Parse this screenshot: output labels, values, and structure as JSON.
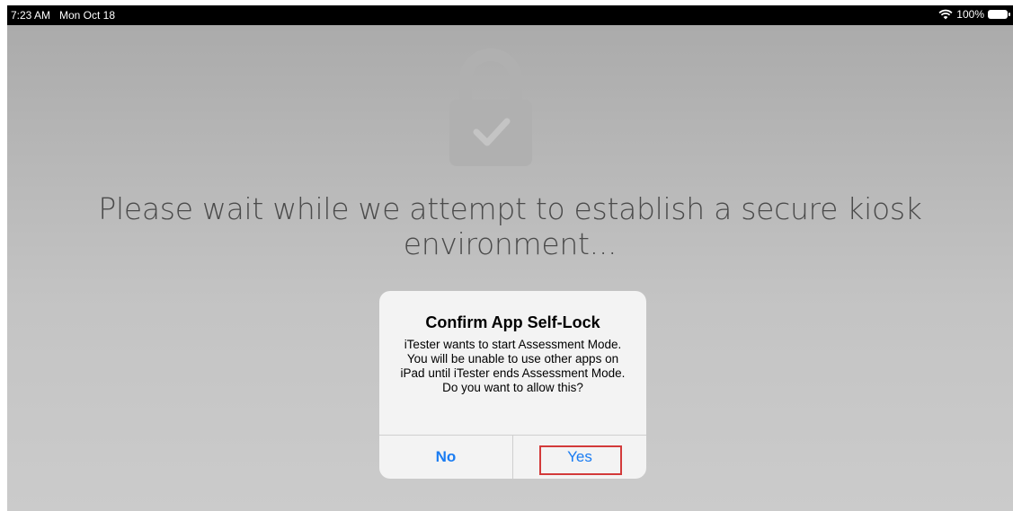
{
  "status_bar": {
    "time": "7:23 AM",
    "date": "Mon Oct 18",
    "battery": "100%"
  },
  "main": {
    "message": "Please wait while we attempt to establish a secure kiosk environment..."
  },
  "dialog": {
    "title": "Confirm App Self-Lock",
    "body": "iTester wants to start Assessment Mode. You will be unable to use other apps on iPad until iTester ends Assessment Mode. Do you want to allow this?",
    "no_label": "No",
    "yes_label": "Yes"
  },
  "icons": {
    "status": [
      "wifi-icon",
      "battery-icon"
    ],
    "background": "lock-check-icon"
  },
  "colors": {
    "accent": "#1a7cf2",
    "highlight": "#d33a3a"
  }
}
